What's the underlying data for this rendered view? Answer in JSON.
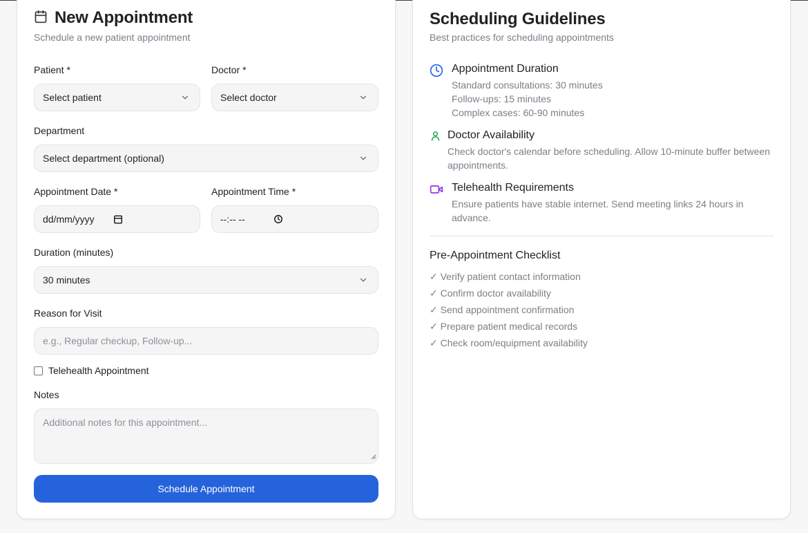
{
  "form": {
    "title": "New Appointment",
    "subtitle": "Schedule a new patient appointment",
    "icon": "calendar-icon",
    "patient_label": "Patient *",
    "patient_value": "Select patient",
    "doctor_label": "Doctor *",
    "doctor_value": "Select doctor",
    "department_label": "Department",
    "department_value": "Select department (optional)",
    "date_label": "Appointment Date *",
    "date_value": "dd/mm/yyyy",
    "time_label": "Appointment Time *",
    "time_value": "--:-- --",
    "duration_label": "Duration (minutes)",
    "duration_value": "30 minutes",
    "reason_label": "Reason for Visit",
    "reason_placeholder": "e.g., Regular checkup, Follow-up...",
    "telehealth_label": "Telehealth Appointment",
    "telehealth_checked": false,
    "notes_label": "Notes",
    "notes_placeholder": "Additional notes for this appointment...",
    "submit_label": "Schedule Appointment"
  },
  "guidelines": {
    "title": "Scheduling Guidelines",
    "subtitle": "Best practices for scheduling appointments",
    "items": [
      {
        "icon": "clock-icon",
        "color": "#2563eb",
        "title": "Appointment Duration",
        "lines": [
          "Standard consultations: 30 minutes",
          "Follow-ups: 15 minutes",
          "Complex cases: 60-90 minutes"
        ]
      },
      {
        "icon": "user-icon",
        "color": "#16a34a",
        "title": "Doctor Availability",
        "lines": [
          "Check doctor's calendar before scheduling. Allow 10-minute buffer between",
          "appointments."
        ]
      },
      {
        "icon": "video-icon",
        "color": "#9333ea",
        "title": "Telehealth Requirements",
        "lines": [
          "Ensure patients have stable internet. Send meeting links 24 hours in",
          "advance."
        ]
      }
    ],
    "checklist_title": "Pre-Appointment Checklist",
    "checklist": [
      "✓ Verify patient contact information",
      "✓ Confirm doctor availability",
      "✓ Send appointment confirmation",
      "✓ Prepare patient medical records",
      "✓ Check room/equipment availability"
    ]
  },
  "colors": {
    "accent": "#2563dc",
    "muted_text": "#7a7f87"
  }
}
